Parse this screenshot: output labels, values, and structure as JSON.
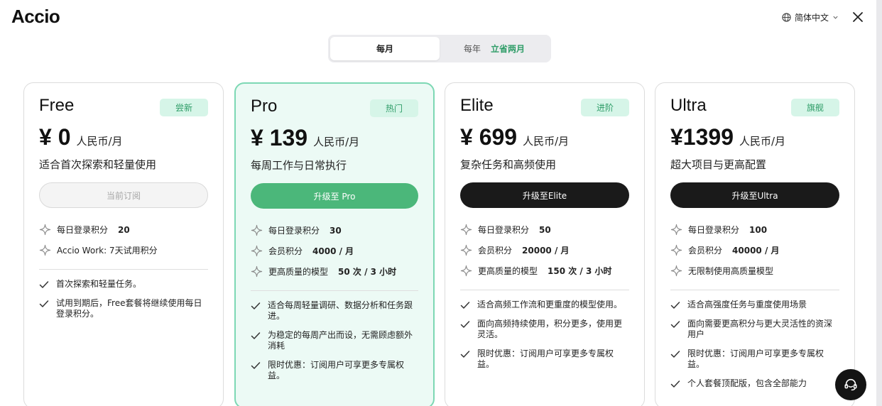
{
  "header": {
    "logo": "Accio",
    "language": "简体中文",
    "icons": {
      "globe": "globe-icon",
      "chevron": "chevron-down-icon",
      "close": "close-icon"
    }
  },
  "billing_toggle": {
    "monthly": "每月",
    "yearly": "每年",
    "yearly_promo": "立省两月",
    "selected": "monthly"
  },
  "colors": {
    "accent_green": "#4bb77a",
    "badge_green": "#2f9d68",
    "badge_bg": "#d6f5e8",
    "pro_bg": "#ecfaf5",
    "pro_border": "#7dd8b4"
  },
  "plans": [
    {
      "name": "Free",
      "badge": "尝新",
      "price": "¥ 0",
      "unit": "人民币/月",
      "desc": "适合首次探索和轻量使用",
      "button": "当前订阅",
      "button_style": "disabled",
      "credits": [
        {
          "label": "每日登录积分",
          "value": "20"
        },
        {
          "label": "Accio Work: 7天试用积分",
          "value": ""
        }
      ],
      "features": [
        "首次探索和轻量任务。",
        "试用到期后，Free套餐将继续使用每日登录积分。"
      ]
    },
    {
      "name": "Pro",
      "badge": "热门",
      "price": "¥ 139",
      "unit": "人民币/月",
      "desc": "每周工作与日常执行",
      "button": "升级至 Pro",
      "button_style": "green",
      "credits": [
        {
          "label": "每日登录积分",
          "value": "30"
        },
        {
          "label": "会员积分",
          "value": "4000 / 月"
        },
        {
          "label": "更高质量的模型",
          "value": "50 次 / 3 小时"
        }
      ],
      "features": [
        "适合每周轻量调研、数据分析和任务跟进。",
        "为稳定的每周产出而设，无需顾虑额外消耗",
        "限时优惠：订阅用户可享更多专属权益。"
      ]
    },
    {
      "name": "Elite",
      "badge": "进阶",
      "price": "¥ 699",
      "unit": "人民币/月",
      "desc": "复杂任务和高频使用",
      "button": "升级至Elite",
      "button_style": "black",
      "credits": [
        {
          "label": "每日登录积分",
          "value": "50"
        },
        {
          "label": "会员积分",
          "value": "20000 / 月"
        },
        {
          "label": "更高质量的模型",
          "value": "150 次 / 3 小时"
        }
      ],
      "features": [
        "适合高频工作流和更重度的模型使用。",
        "面向高频持续使用，积分更多，使用更灵活。",
        "限时优惠：订阅用户可享更多专属权益。"
      ]
    },
    {
      "name": "Ultra",
      "badge": "旗舰",
      "price": "¥1399",
      "unit": "人民币/月",
      "desc": "超大项目与更高配置",
      "button": "升级至Ultra",
      "button_style": "black",
      "credits": [
        {
          "label": "每日登录积分",
          "value": "100"
        },
        {
          "label": "会员积分",
          "value": "40000 / 月"
        },
        {
          "label": "无限制使用高质量模型",
          "value": ""
        }
      ],
      "features": [
        "适合高强度任务与重度使用场景",
        "面向需要更高积分与更大灵活性的资深用户",
        "限时优惠：订阅用户可享更多专属权益。",
        "个人套餐顶配版，包含全部能力"
      ]
    }
  ],
  "support_icon": "support-agent-icon"
}
